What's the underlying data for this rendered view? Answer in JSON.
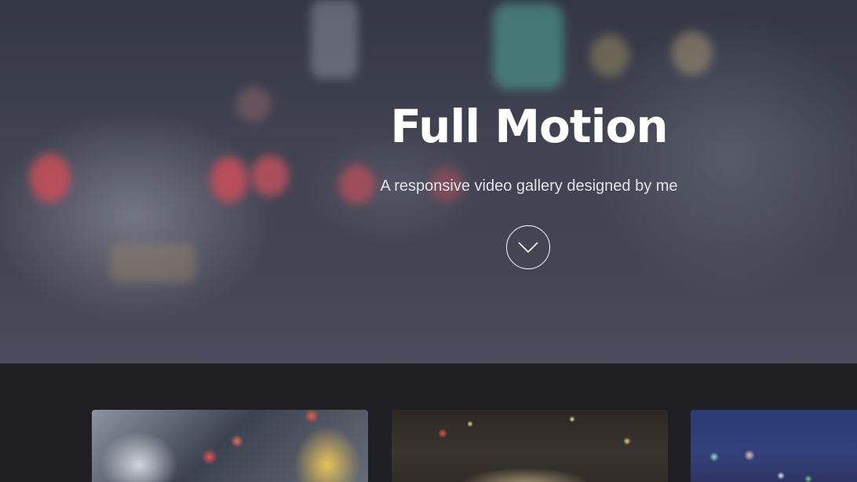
{
  "hero": {
    "title": "Full Motion",
    "subtitle": "A responsive video gallery designed by me",
    "scroll_icon": "chevron-down-icon"
  },
  "gallery": {
    "cards": [
      {
        "thumbnail": "city-traffic-taxis-thumbnail"
      },
      {
        "thumbnail": "night-city-street-motion-thumbnail"
      },
      {
        "thumbnail": "blue-night-city-lights-thumbnail"
      }
    ]
  },
  "colors": {
    "hero_text": "#ffffff",
    "subtitle_text": "#e3e3ea",
    "gallery_background": "#1f1e23"
  }
}
